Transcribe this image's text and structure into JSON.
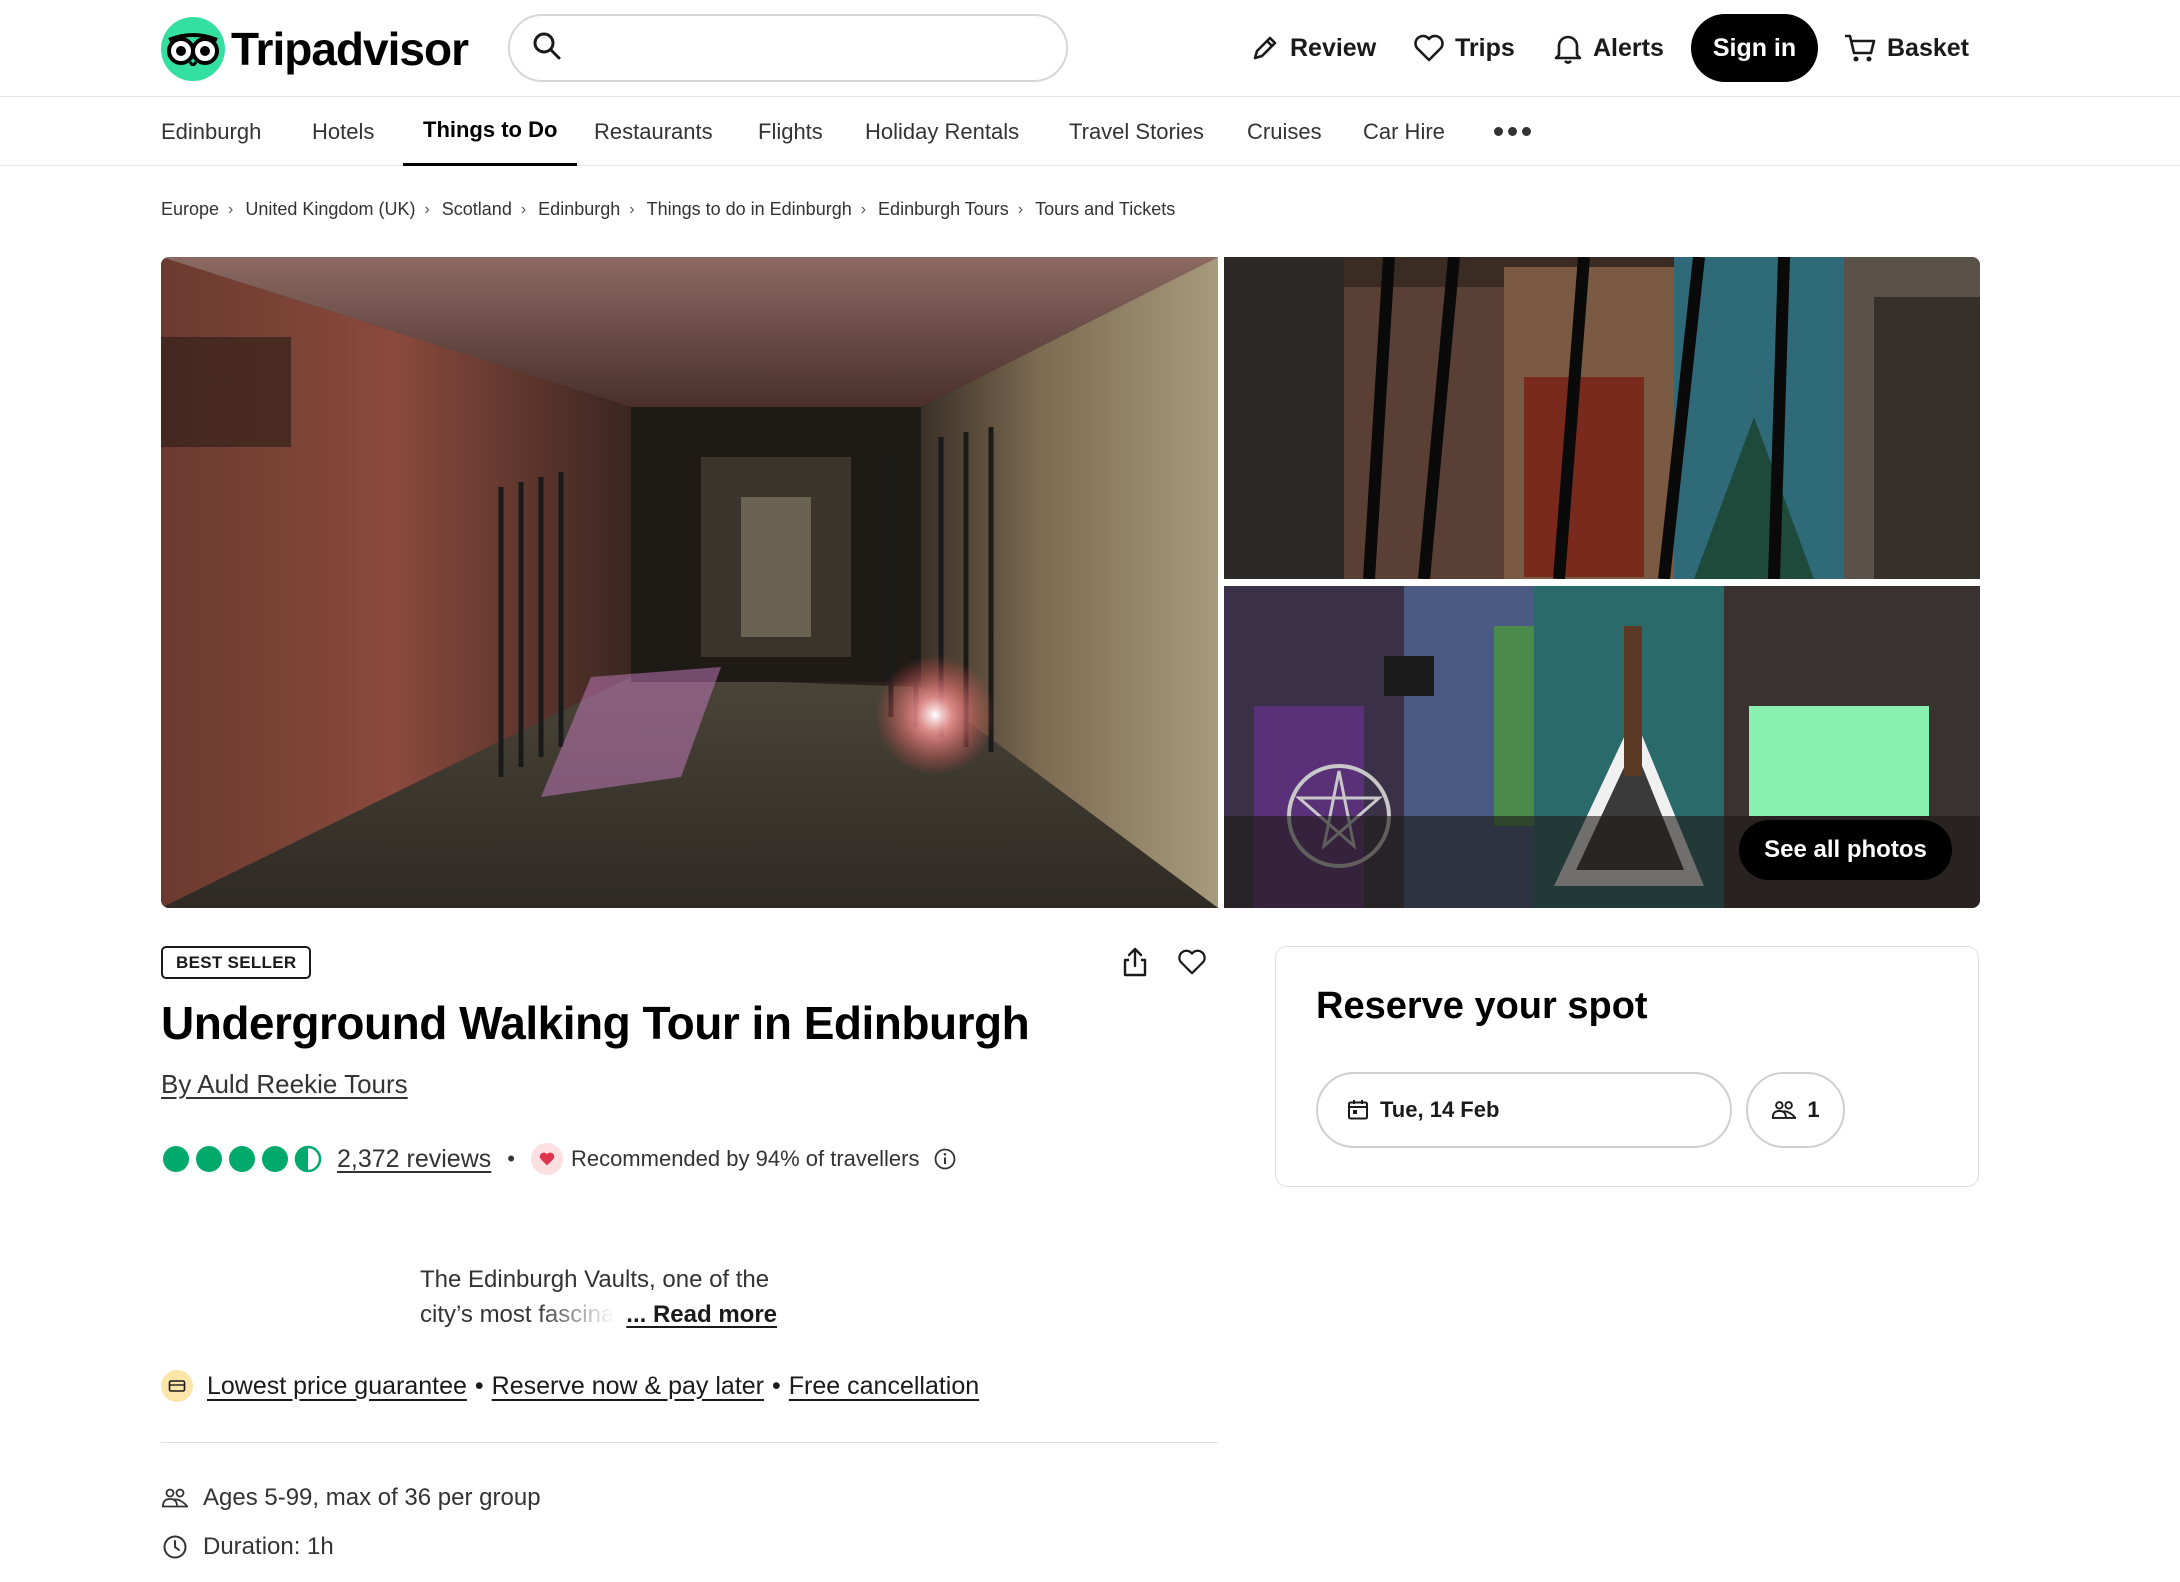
{
  "header": {
    "logo_text": "Tripadvisor",
    "search_placeholder": "",
    "nav": {
      "review": "Review",
      "trips": "Trips",
      "alerts": "Alerts",
      "sign_in": "Sign in",
      "basket": "Basket"
    }
  },
  "subnav": {
    "tabs": [
      "Edinburgh",
      "Hotels",
      "Things to Do",
      "Restaurants",
      "Flights",
      "Holiday Rentals",
      "Travel Stories",
      "Cruises",
      "Car Hire"
    ],
    "active_tab": "Things to Do",
    "more_icon": "more-dots-icon"
  },
  "breadcrumb": [
    "Europe",
    "United Kingdom (UK)",
    "Scotland",
    "Edinburgh",
    "Things to do in Edinburgh",
    "Edinburgh Tours",
    "Tours and Tickets"
  ],
  "gallery": {
    "see_all_label": "See all photos"
  },
  "product": {
    "badge": "BEST SELLER",
    "title": "Underground Walking Tour in Edinburgh",
    "byline": "By Auld Reekie Tours",
    "rating": 4.5,
    "rating_max": 5,
    "reviews_label": "2,372 reviews",
    "bullet": "•",
    "recommended_text": "Recommended by 94% of travellers",
    "description_line1": "The Edinburgh Vaults, one of the",
    "description_line2": "city’s most fascina",
    "read_more_label": "... Read more",
    "guarantees": [
      "Lowest price guarantee",
      "Reserve now & pay later",
      "Free cancellation"
    ],
    "guarantee_sep": "•",
    "features": {
      "ages": "Ages 5-99, max of 36 per group",
      "duration": "Duration: 1h"
    }
  },
  "reserve": {
    "title": "Reserve your spot",
    "date_label": "Tue, 14 Feb",
    "travellers_label": "1"
  },
  "colors": {
    "brand_green": "#34e0a1",
    "rating_green": "#00aa6c",
    "black": "#000000"
  }
}
